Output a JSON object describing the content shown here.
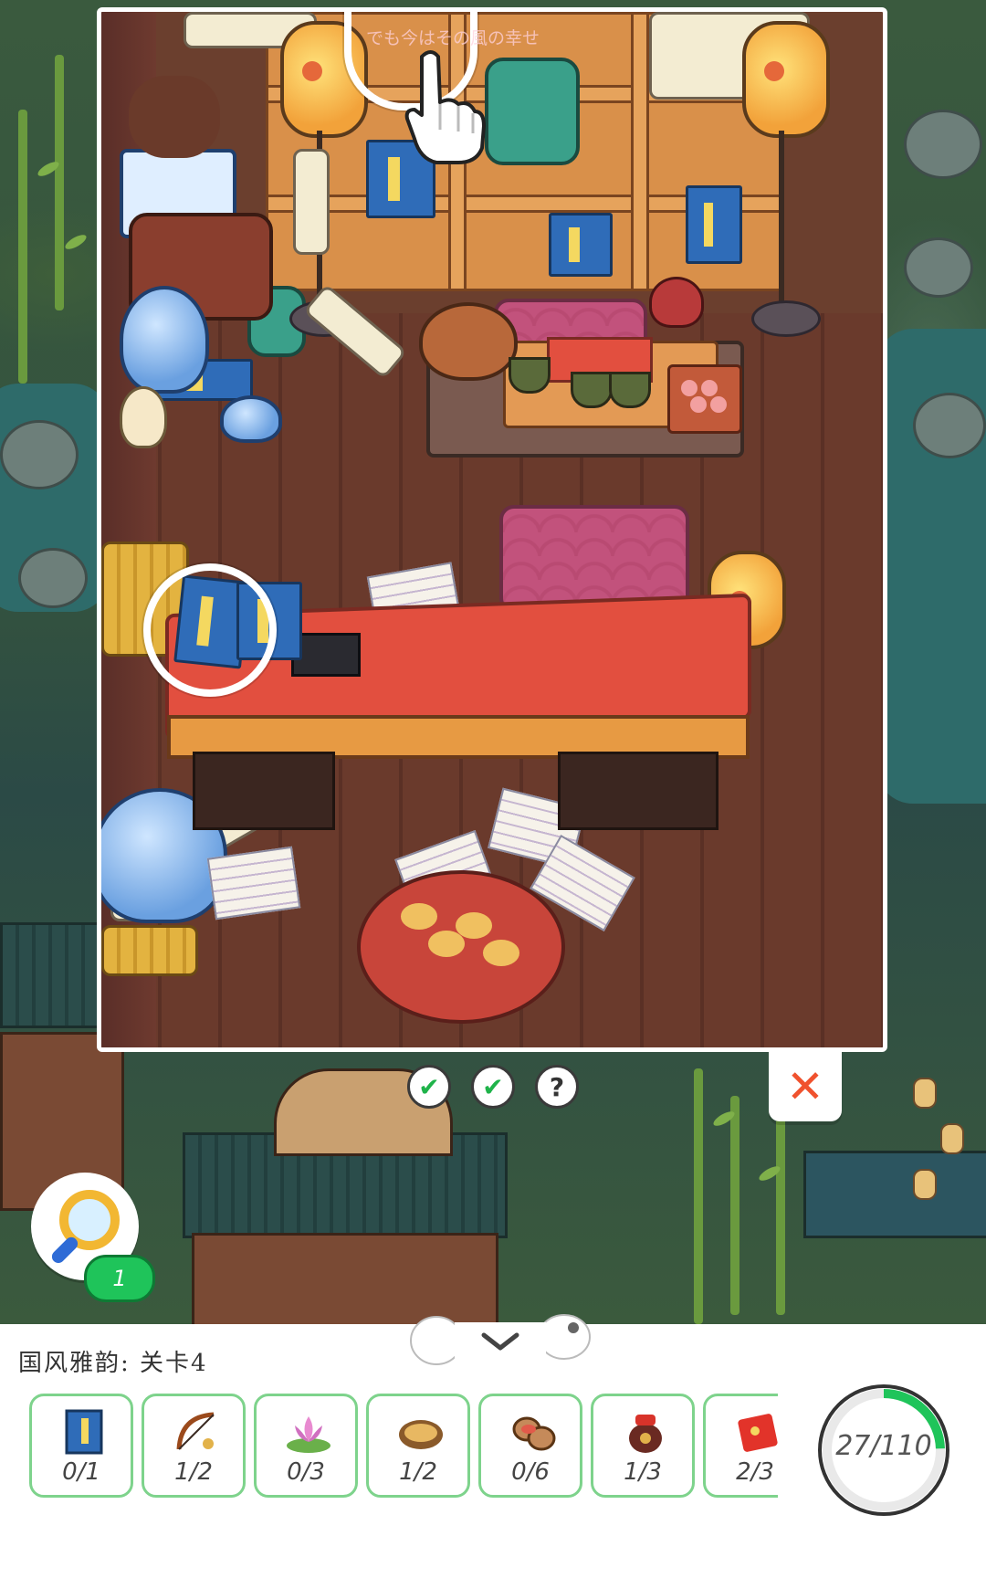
{
  "view": {
    "watermark": "でも今はその風の幸せ",
    "hints": [
      {
        "state": "found",
        "glyph": "✔"
      },
      {
        "state": "found",
        "glyph": "✔"
      },
      {
        "state": "unknown",
        "glyph": "?"
      }
    ],
    "close_glyph": "✕"
  },
  "magnifier": {
    "count": "1"
  },
  "panel": {
    "level_title": "国风雅韵: 关卡4",
    "items": [
      {
        "name": "book",
        "icon": "book-icon",
        "count": "0/1"
      },
      {
        "name": "bow",
        "icon": "bow-icon",
        "count": "1/2"
      },
      {
        "name": "lotus",
        "icon": "lotus-icon",
        "count": "0/3"
      },
      {
        "name": "walnut",
        "icon": "walnut-icon",
        "count": "1/2"
      },
      {
        "name": "peanut",
        "icon": "peanut-icon",
        "count": "0/6"
      },
      {
        "name": "jar",
        "icon": "jar-icon",
        "count": "1/3"
      },
      {
        "name": "red-envelope",
        "icon": "red-envelope-icon",
        "count": "2/3"
      }
    ],
    "progress": {
      "text": "27/110",
      "found": 27,
      "total": 110
    },
    "colors": {
      "accent": "#1fc45a",
      "border": "#7ed38c",
      "close": "#f0522e"
    }
  }
}
